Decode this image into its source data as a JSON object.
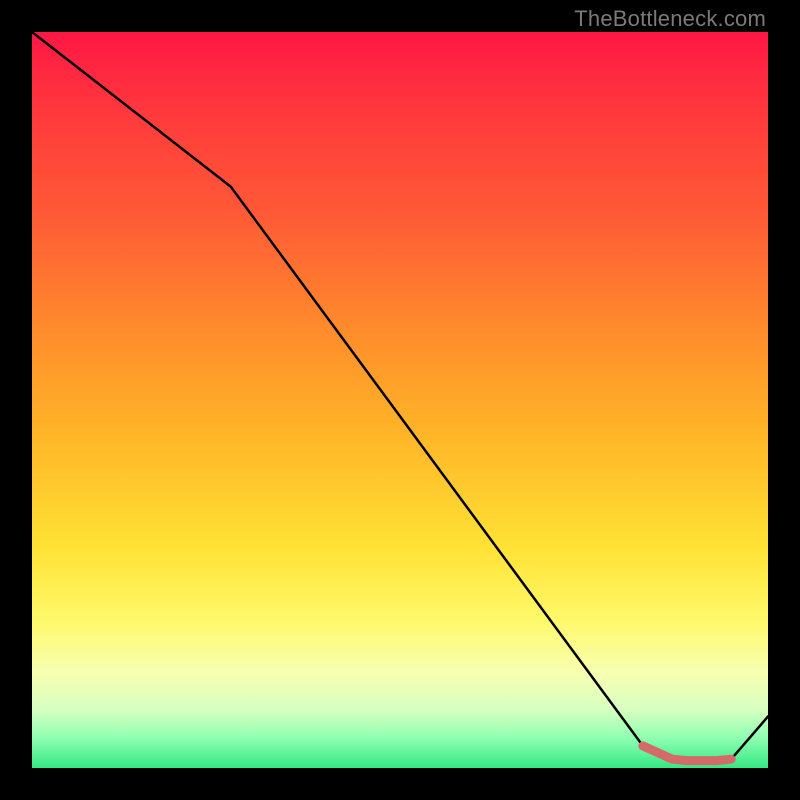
{
  "attribution": "TheBottleneck.com",
  "chart_data": {
    "type": "line",
    "title": "",
    "xlabel": "",
    "ylabel": "",
    "xlim": [
      0,
      100
    ],
    "ylim": [
      0,
      100
    ],
    "series": [
      {
        "name": "curve",
        "x": [
          0,
          27,
          83,
          87,
          89,
          91,
          93,
          95,
          100
        ],
        "values": [
          100,
          79,
          3,
          1.2,
          1.0,
          1.0,
          1.0,
          1.2,
          7
        ]
      }
    ],
    "highlight": {
      "name": "bottom-plateau",
      "color": "#d46a6a",
      "x": [
        83,
        87,
        89,
        91,
        93,
        95
      ],
      "values": [
        3,
        1.2,
        1.0,
        1.0,
        1.0,
        1.2
      ]
    }
  }
}
